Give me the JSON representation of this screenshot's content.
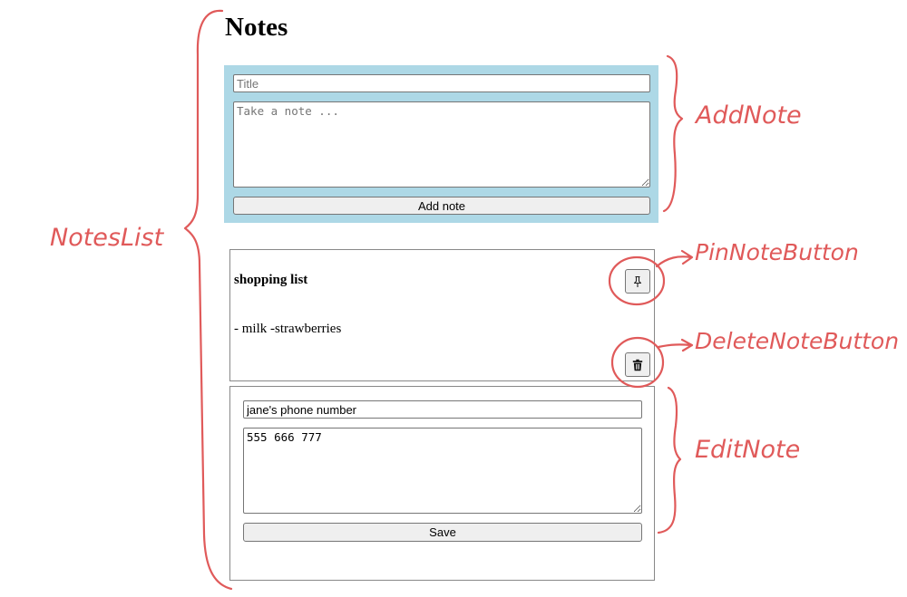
{
  "page": {
    "title": "Notes"
  },
  "add_note": {
    "title_placeholder": "Title",
    "body_placeholder": "Take a note ...",
    "button_label": "Add note",
    "panel_color": "#add8e6"
  },
  "notes": [
    {
      "title": "shopping list",
      "body": "- milk -strawberries",
      "pin_icon": "pin-icon",
      "delete_icon": "trash-icon"
    }
  ],
  "edit_note": {
    "title_value": "jane's phone number",
    "body_value": "555 666 777",
    "save_label": "Save"
  },
  "annotations": {
    "notes_list": "NotesList",
    "add_note": "AddNote",
    "pin_note_button": "PinNoteButton",
    "delete_note_button": "DeleteNoteButton",
    "edit_note": "EditNote",
    "color": "#e05a5a"
  }
}
